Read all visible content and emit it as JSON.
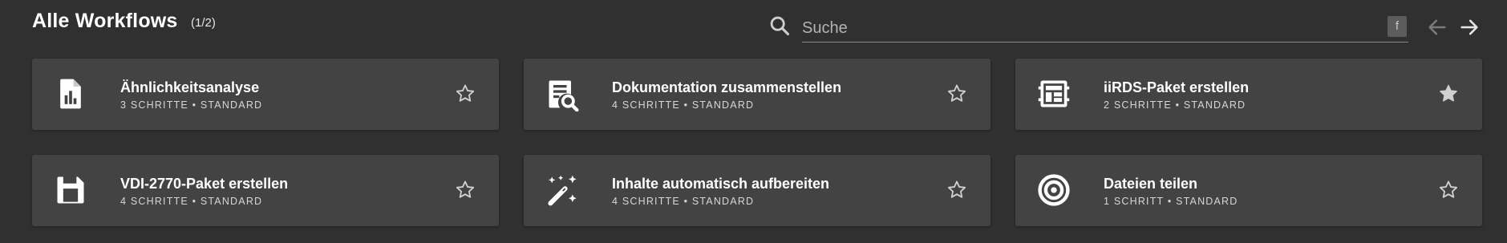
{
  "header": {
    "title": "Alle Workflows",
    "pager": "(1/2)",
    "search_placeholder": "Suche",
    "filter_badge": "f"
  },
  "cards": [
    {
      "title": "Ähnlichkeitsanalyse",
      "meta": "3 SCHRITTE • STANDARD",
      "icon": "bar-chart-document-icon",
      "favorite": false
    },
    {
      "title": "Dokumentation zusammenstellen",
      "meta": "4 SCHRITTE • STANDARD",
      "icon": "document-search-icon",
      "favorite": false
    },
    {
      "title": "iiRDS-Paket erstellen",
      "meta": "2 SCHRITTE • STANDARD",
      "icon": "package-grid-icon",
      "favorite": true
    },
    {
      "title": "VDI-2770-Paket erstellen",
      "meta": "4 SCHRITTE • STANDARD",
      "icon": "floppy-save-icon",
      "favorite": false
    },
    {
      "title": "Inhalte automatisch aufbereiten",
      "meta": "4 SCHRITTE • STANDARD",
      "icon": "magic-wand-icon",
      "favorite": false
    },
    {
      "title": "Dateien teilen",
      "meta": "1 SCHRITT • STANDARD",
      "icon": "target-icon",
      "favorite": false
    }
  ],
  "colors": {
    "background": "#303030",
    "card": "#434343",
    "text": "#ffffff",
    "muted": "#d6d6d6"
  }
}
